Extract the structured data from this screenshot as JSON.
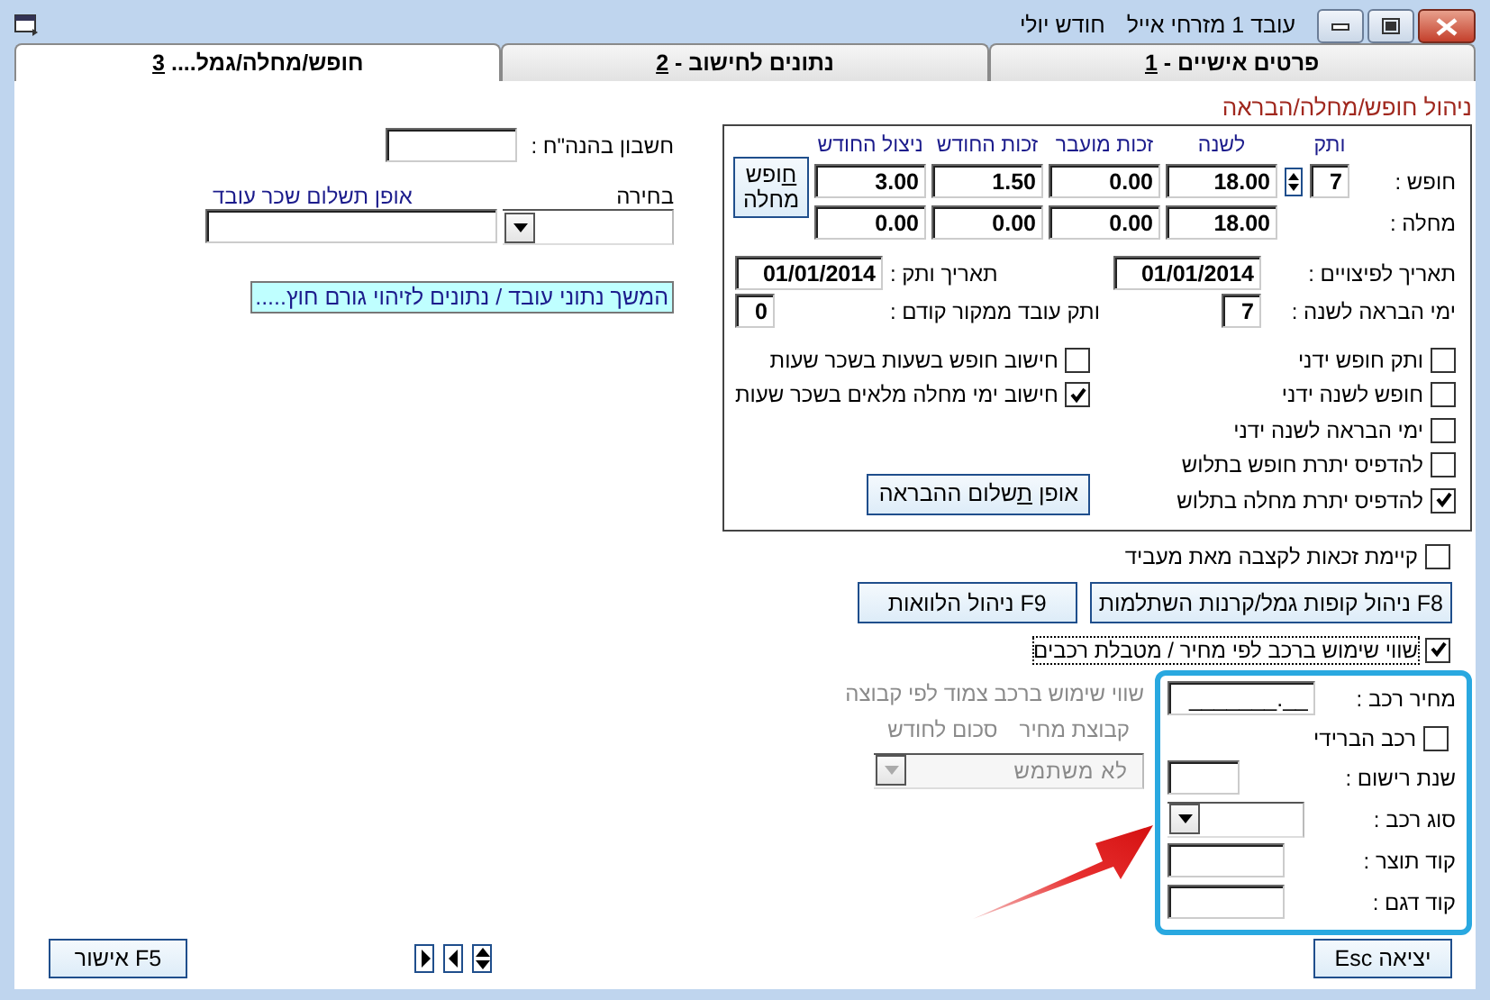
{
  "window": {
    "title": "עובד 1 מזרחי אייל",
    "month": "חודש יולי"
  },
  "tabs": [
    {
      "text": "פרטים אישיים -",
      "key": "1",
      "selected": false
    },
    {
      "text": "נתונים לחישוב -",
      "key": "2",
      "selected": false
    },
    {
      "text": "חופש/מחלה/גמל....",
      "key": "3",
      "selected": true
    }
  ],
  "leave": {
    "title": "ניהול חופש/מחלה/הבראה",
    "columns": [
      "ותק",
      "לשנה",
      "זכות מועבר",
      "זכות החודש",
      "ניצול החודש"
    ],
    "rows": [
      {
        "label": "חופש :",
        "seniority": "7",
        "values": [
          "18.00",
          "0.00",
          "1.50",
          "3.00"
        ]
      },
      {
        "label": "מחלה :",
        "values": [
          "18.00",
          "0.00",
          "0.00",
          "0.00"
        ]
      }
    ],
    "switch_button": {
      "key": "ח",
      "rest": "ופש",
      "second_line": "מחלה"
    },
    "fields": [
      {
        "label": "תאריך לפיצויים :",
        "value": "01/01/2014",
        "kind": "wide"
      },
      {
        "label": "תאריך ותק :",
        "value": "01/01/2014",
        "kind": "wide"
      },
      {
        "label": "ימי הבראה לשנה :",
        "value": "7",
        "kind": "narrow"
      },
      {
        "label": "ותק עובד ממקור קודם :",
        "value": "0",
        "kind": "narrow"
      }
    ],
    "options_right": [
      {
        "label": "ותק חופש ידני",
        "checked": false
      },
      {
        "label": "חופש לשנה ידני",
        "checked": false
      },
      {
        "label": "ימי הבראה לשנה ידני",
        "checked": false
      },
      {
        "label": "להדפיס יתרת חופש בתלוש",
        "checked": false
      },
      {
        "label": "להדפיס יתרת מחלה בתלוש",
        "checked": true
      }
    ],
    "options_left": [
      {
        "label": "חישוב חופש בשעות בשכר שעות",
        "checked": false
      },
      {
        "label": "חישוב ימי מחלה מלאים בשכר שעות",
        "checked": true
      }
    ],
    "payment_button": {
      "before": "אופן",
      "key": "ת",
      "after": "שלום ההבראה"
    }
  },
  "pension": {
    "label": "קיימת זכאות לקצבה מאת מעביד",
    "checked": false
  },
  "function_buttons": [
    "F8 ניהול קופות גמל/קרנות השתלמות",
    "F9 ניהול הלוואות"
  ],
  "car": {
    "label": "שווי שימוש ברכב לפי מחיר / מטבלת רכבים",
    "checked": true,
    "price_label": "מחיר רכב :",
    "price_value": "_______.__",
    "hybrid": {
      "label": "רכב הברידי",
      "checked": false
    },
    "fields": [
      {
        "kind": "short_text",
        "label": "שנת רישום :"
      },
      {
        "kind": "dropdown",
        "label": "סוג רכב :"
      },
      {
        "kind": "text",
        "label": "קוד תוצר :"
      },
      {
        "kind": "text",
        "label": "קוד דגם :"
      }
    ]
  },
  "group": {
    "title": "שווי שימוש ברכב צמוד לפי קבוצה",
    "columns": [
      "קבוצת מחיר",
      "סכום לחודש"
    ],
    "value": "לא משתמש",
    "disabled": true
  },
  "left": {
    "account_label": "חשבון בהנה\"ח :",
    "choice_label": "בחירה",
    "payment_label": "אופן תשלום שכר עובד",
    "continue_button": "המשך נתוני עובד / נתונים לזיהוי גורם חוץ....."
  },
  "footer": {
    "exit_button": "יציאה Esc",
    "ok_button": "F5 אישור"
  }
}
